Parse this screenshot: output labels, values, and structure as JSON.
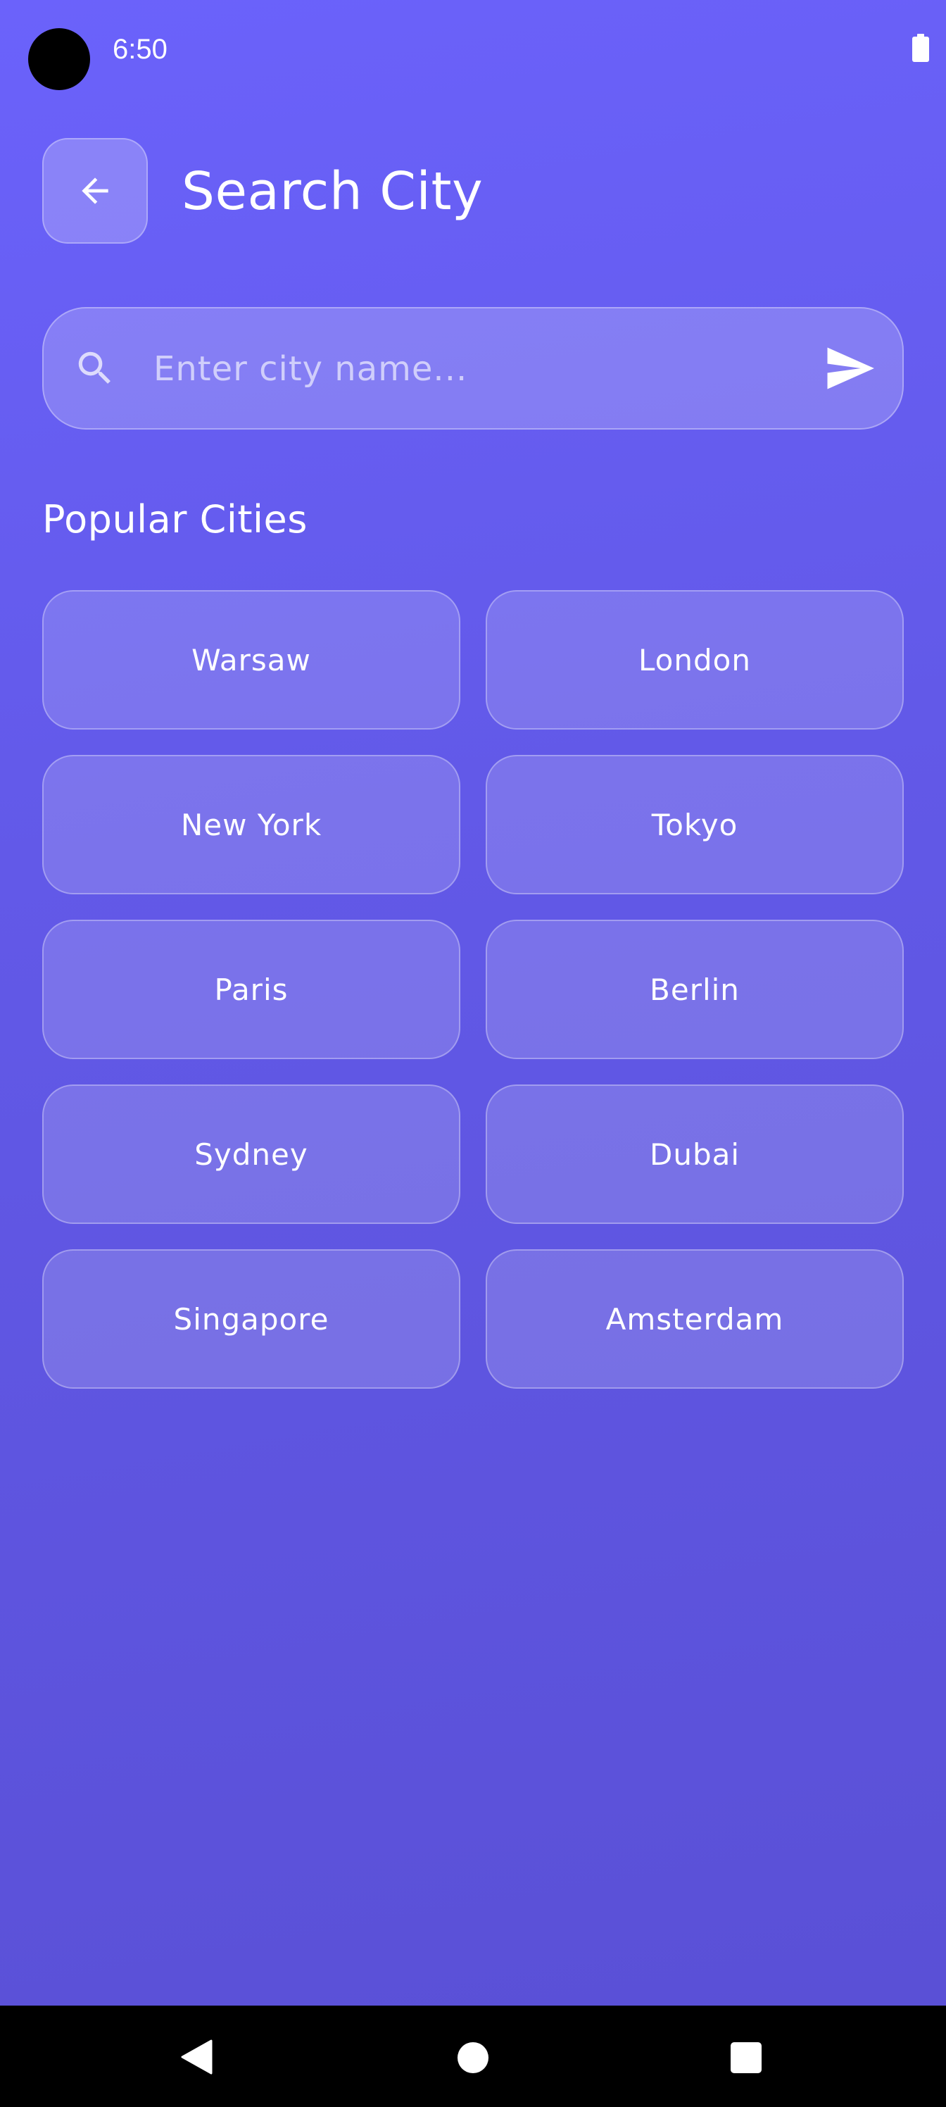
{
  "status_bar": {
    "time": "6:50"
  },
  "header": {
    "back_icon": "arrow-left-icon",
    "title": "Search City"
  },
  "search": {
    "placeholder": "Enter city name...",
    "value": "",
    "search_icon": "search-icon",
    "send_icon": "send-icon"
  },
  "popular": {
    "title": "Popular Cities",
    "cities": [
      "Warsaw",
      "London",
      "New York",
      "Tokyo",
      "Paris",
      "Berlin",
      "Sydney",
      "Dubai",
      "Singapore",
      "Amsterdam"
    ]
  },
  "nav_bar": {
    "back_icon": "triangle-back-icon",
    "home_icon": "circle-home-icon",
    "recents_icon": "square-recents-icon"
  },
  "colors": {
    "gradient_top": "#6b62fb",
    "gradient_bottom": "#5a50d6",
    "text": "#ffffff"
  }
}
